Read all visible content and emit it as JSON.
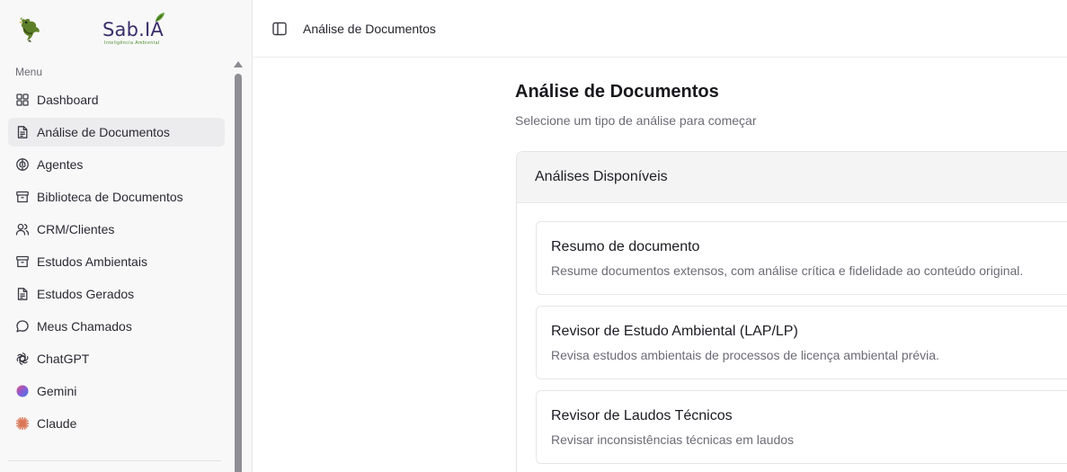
{
  "brand": {
    "name": "Sab.IA",
    "tagline": "Inteligência Ambiental"
  },
  "sidebar": {
    "menu_label": "Menu",
    "items": [
      {
        "label": "Dashboard",
        "icon": "grid-icon",
        "active": false
      },
      {
        "label": "Análise de Documentos",
        "icon": "file-text-icon",
        "active": true
      },
      {
        "label": "Agentes",
        "icon": "brain-icon",
        "active": false
      },
      {
        "label": "Biblioteca de Documentos",
        "icon": "archive-icon",
        "active": false
      },
      {
        "label": "CRM/Clientes",
        "icon": "users-icon",
        "active": false
      },
      {
        "label": "Estudos Ambientais",
        "icon": "archive-icon",
        "active": false
      },
      {
        "label": "Estudos Gerados",
        "icon": "file-text-icon",
        "active": false
      },
      {
        "label": "Meus Chamados",
        "icon": "message-circle-icon",
        "active": false
      },
      {
        "label": "ChatGPT",
        "icon": "openai-icon",
        "active": false
      },
      {
        "label": "Gemini",
        "icon": "gemini-icon",
        "active": false
      },
      {
        "label": "Claude",
        "icon": "claude-icon",
        "active": false
      }
    ]
  },
  "header": {
    "title": "Análise de Documentos"
  },
  "main": {
    "title": "Análise de Documentos",
    "subtitle": "Selecione um tipo de análise para começar",
    "panel_title": "Análises Disponíveis",
    "cards": [
      {
        "title": "Resumo de documento",
        "description": "Resume documentos extensos, com análise crítica e fidelidade ao conteúdo original."
      },
      {
        "title": "Revisor de Estudo Ambiental (LAP/LP)",
        "description": "Revisa estudos ambientais de processos de licença ambiental prévia."
      },
      {
        "title": "Revisor de Laudos Técnicos",
        "description": "Revisar inconsistências técnicas em laudos"
      }
    ]
  },
  "colors": {
    "sidebar_bg": "#f8f8f9",
    "active_item_bg": "#ececee",
    "brand_purple": "#3a2e6a",
    "brand_green": "#4a8a2a",
    "claude_orange": "#d97757"
  }
}
